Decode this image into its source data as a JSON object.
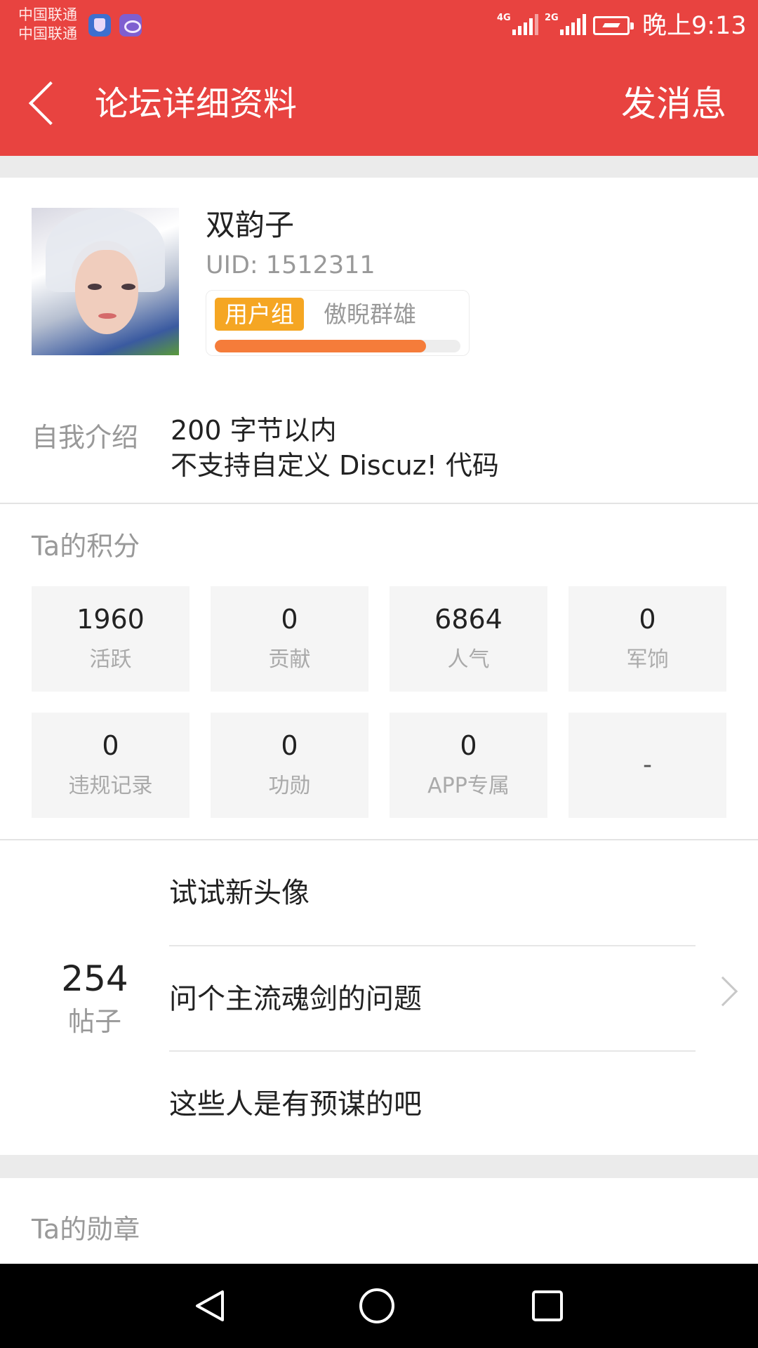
{
  "status_bar": {
    "carrier_1": "中国联通",
    "carrier_2": "中国联通",
    "network_1": "4G",
    "network_2": "2G",
    "time": "晚上9:13",
    "app_icons": [
      "shield-app-icon",
      "swirl-app-icon"
    ]
  },
  "header": {
    "back_icon": "chevron-left-icon",
    "title": "论坛详细资料",
    "action": "发消息",
    "color": "#e84340"
  },
  "profile": {
    "username": "双韵子",
    "uid": "UID: 1512311",
    "group_badge": "用户组",
    "group_name": "傲睨群雄",
    "group_progress": 0.86,
    "badge_color": "#f5a623",
    "progress_color": "#f57c3a",
    "intro_label": "自我介绍",
    "intro_line_1": "200 字节以内",
    "intro_line_2": "不支持自定义 Discuz! 代码"
  },
  "points": {
    "title": "Ta的积分",
    "stats": [
      {
        "value": "1960",
        "label": "活跃"
      },
      {
        "value": "0",
        "label": "贡献"
      },
      {
        "value": "6864",
        "label": "人气"
      },
      {
        "value": "0",
        "label": "军饷"
      },
      {
        "value": "0",
        "label": "违规记录"
      },
      {
        "value": "0",
        "label": "功勋"
      },
      {
        "value": "0",
        "label": "APP专属"
      },
      {
        "value": "-",
        "label": ""
      }
    ]
  },
  "posts": {
    "count": "254",
    "count_label": "帖子",
    "items": [
      "试试新头像",
      "问个主流魂剑的问题",
      "这些人是有预谋的吧"
    ]
  },
  "medals": {
    "title": "Ta的勋章"
  },
  "nav_bar": {
    "icons": [
      "nav-back-icon",
      "nav-home-icon",
      "nav-recent-icon"
    ]
  }
}
